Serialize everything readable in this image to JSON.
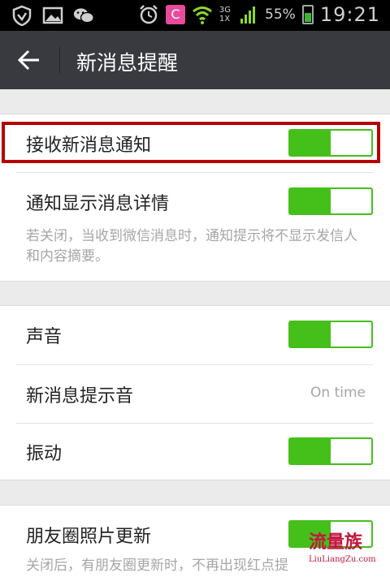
{
  "status_bar": {
    "battery_percent": "55%",
    "time": "19:21",
    "network_top": "3G",
    "network_bottom": "1X",
    "app_letter": "C",
    "icons": [
      "shield-icon",
      "gallery-icon",
      "wechat-icon",
      "alarm-icon",
      "app-icon",
      "wifi-icon",
      "signal-icon",
      "battery-icon"
    ]
  },
  "action_bar": {
    "title": "新消息提醒",
    "back_icon": "back-arrow-icon"
  },
  "settings": {
    "receive_notifications": {
      "label": "接收新消息通知",
      "enabled": true
    },
    "show_details": {
      "label": "通知显示消息详情",
      "enabled": true,
      "description": "若关闭，当收到微信消息时，通知提示将不显示发信人和内容摘要。"
    },
    "sound": {
      "label": "声音",
      "enabled": true
    },
    "ringtone": {
      "label": "新消息提示音",
      "value": "On time"
    },
    "vibrate": {
      "label": "振动",
      "enabled": true
    },
    "moments": {
      "label": "朋友圈照片更新",
      "enabled": true,
      "description": "关闭后，有朋友圈更新时，不再出现红点提"
    }
  },
  "watermark": {
    "main": "流量族",
    "sub": "LiuLiangZu.com"
  },
  "colors": {
    "accent_green": "#45c01a",
    "action_bar": "#393a3f",
    "highlight": "#b50000"
  }
}
